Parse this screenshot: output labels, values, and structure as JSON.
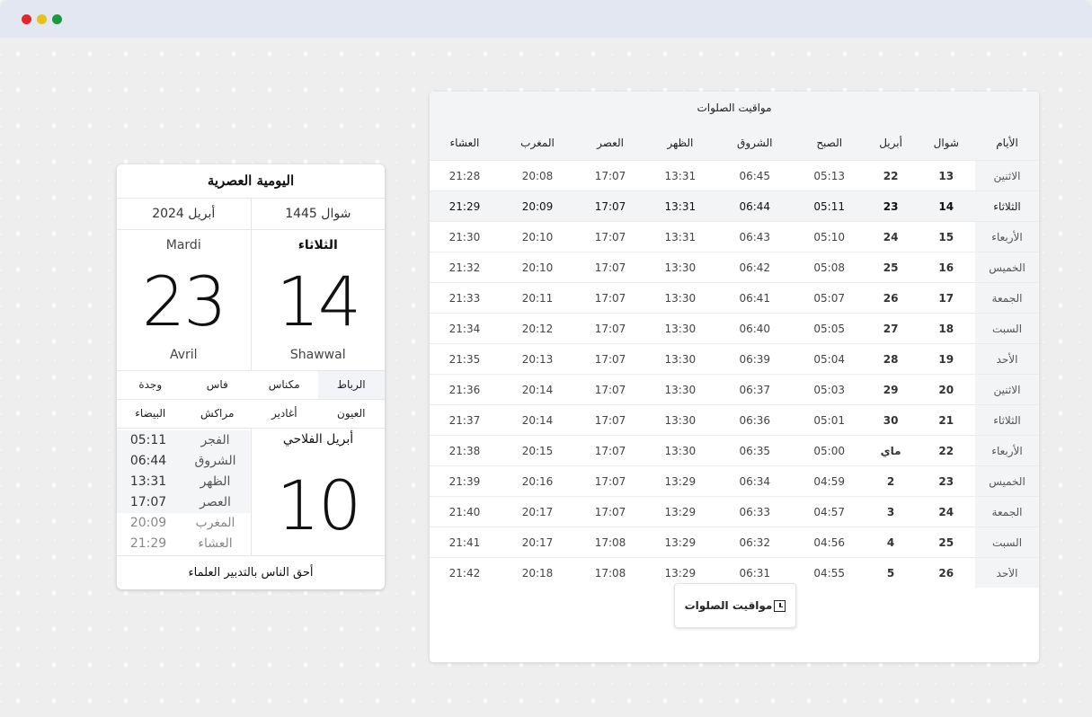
{
  "card": {
    "title": "اليومية العصرية",
    "hijri_month_year": "شوال 1445",
    "greg_month_year": "أبريل 2024",
    "day_ar": "الثلاثاء",
    "day_fr": "Mardi",
    "hijri_day": "14",
    "greg_day": "23",
    "hijri_month_fr": "Shawwal",
    "greg_month_fr": "Avril",
    "cities_row1": [
      "الرباط",
      "مكناس",
      "فاس",
      "وجدة"
    ],
    "cities_row2": [
      "العيون",
      "أغادير",
      "مراكش",
      "البيضاء"
    ],
    "active_city": "الرباط",
    "prayers": [
      {
        "name": "الفجر",
        "time": "05:11"
      },
      {
        "name": "الشروق",
        "time": "06:44"
      },
      {
        "name": "الظهر",
        "time": "13:31"
      },
      {
        "name": "العصر",
        "time": "17:07"
      },
      {
        "name": "المغرب",
        "time": "20:09"
      },
      {
        "name": "العشاء",
        "time": "21:29"
      }
    ],
    "agri_label": "أبريل الفلاحي",
    "agri_day": "10",
    "quote": "أحق الناس بالتدبير العلماء"
  },
  "table": {
    "title": "مواقيت الصلوات",
    "headers": [
      "الأيام",
      "شوال",
      "أبريل",
      "الصبح",
      "الشروق",
      "الظهر",
      "العصر",
      "المغرب",
      "العشاء"
    ],
    "rows": [
      [
        "الاثنين",
        "13",
        "22",
        "05:13",
        "06:45",
        "13:31",
        "17:07",
        "20:08",
        "21:28"
      ],
      [
        "الثلاثاء",
        "14",
        "23",
        "05:11",
        "06:44",
        "13:31",
        "17:07",
        "20:09",
        "21:29"
      ],
      [
        "الأربعاء",
        "15",
        "24",
        "05:10",
        "06:43",
        "13:31",
        "17:07",
        "20:10",
        "21:30"
      ],
      [
        "الخميس",
        "16",
        "25",
        "05:08",
        "06:42",
        "13:30",
        "17:07",
        "20:10",
        "21:32"
      ],
      [
        "الجمعة",
        "17",
        "26",
        "05:07",
        "06:41",
        "13:30",
        "17:07",
        "20:11",
        "21:33"
      ],
      [
        "السبت",
        "18",
        "27",
        "05:05",
        "06:40",
        "13:30",
        "17:07",
        "20:12",
        "21:34"
      ],
      [
        "الأحد",
        "19",
        "28",
        "05:04",
        "06:39",
        "13:30",
        "17:07",
        "20:13",
        "21:35"
      ],
      [
        "الاثنين",
        "20",
        "29",
        "05:03",
        "06:37",
        "13:30",
        "17:07",
        "20:14",
        "21:36"
      ],
      [
        "الثلاثاء",
        "21",
        "30",
        "05:01",
        "06:36",
        "13:30",
        "17:07",
        "20:14",
        "21:37"
      ],
      [
        "الأربعاء",
        "22",
        "ماي",
        "05:00",
        "06:35",
        "13:30",
        "17:07",
        "20:15",
        "21:38"
      ],
      [
        "الخميس",
        "23",
        "2",
        "04:59",
        "06:34",
        "13:29",
        "17:07",
        "20:16",
        "21:39"
      ],
      [
        "الجمعة",
        "24",
        "3",
        "04:57",
        "06:33",
        "13:29",
        "17:07",
        "20:17",
        "21:40"
      ],
      [
        "السبت",
        "25",
        "4",
        "04:56",
        "06:32",
        "13:29",
        "17:08",
        "20:17",
        "21:41"
      ],
      [
        "الأحد",
        "26",
        "5",
        "04:55",
        "06:31",
        "13:29",
        "17:08",
        "20:18",
        "21:42"
      ]
    ],
    "today_index": 1
  },
  "button": {
    "label": "مواقيت الصلوات",
    "icon": "clock-icon"
  }
}
